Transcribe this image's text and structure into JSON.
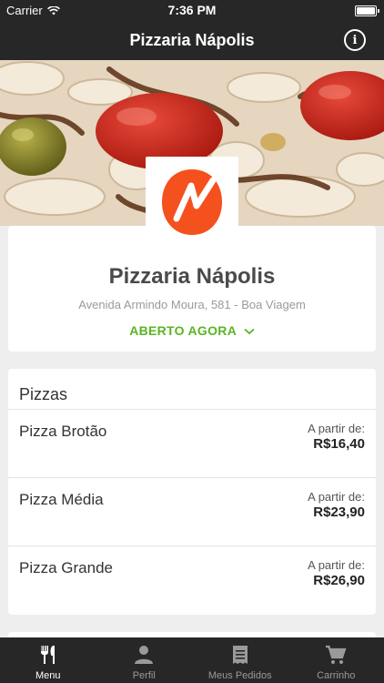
{
  "status_bar": {
    "carrier": "Carrier",
    "time": "7:36 PM"
  },
  "navbar": {
    "title": "Pizzaria Nápolis",
    "info_icon": "info-icon"
  },
  "restaurant": {
    "name": "Pizzaria Nápolis",
    "address": "Avenida Armindo Moura, 581 - Boa Viagem",
    "status": "ABERTO AGORA",
    "status_color": "#5bb523",
    "logo_color": "#f4511e"
  },
  "menu": {
    "section_title": "Pizzas",
    "items": [
      {
        "name": "Pizza Brotão",
        "from_label": "A partir de:",
        "price": "R$16,40"
      },
      {
        "name": "Pizza Média",
        "from_label": "A partir de:",
        "price": "R$23,90"
      },
      {
        "name": "Pizza Grande",
        "from_label": "A partir de:",
        "price": "R$26,90"
      }
    ]
  },
  "tabbar": {
    "tabs": [
      {
        "label": "Menu",
        "icon": "fork-knife-icon",
        "active": true
      },
      {
        "label": "Perfil",
        "icon": "person-icon",
        "active": false
      },
      {
        "label": "Meus Pedidos",
        "icon": "receipt-icon",
        "active": false
      },
      {
        "label": "Carrinho",
        "icon": "cart-icon",
        "active": false
      }
    ]
  },
  "colors": {
    "header_bg": "#272727",
    "accent_green": "#5bb523"
  }
}
